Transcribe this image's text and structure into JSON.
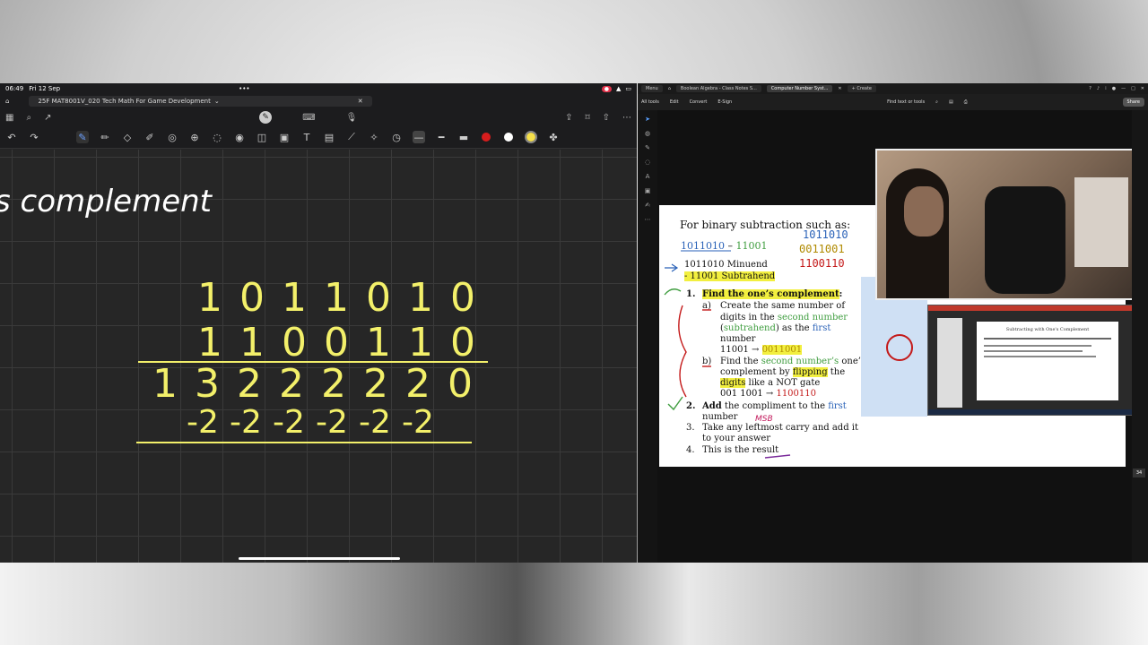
{
  "ipad": {
    "time": "06:49",
    "date": "Fri 12 Sep",
    "notebook_title": "25F MAT8001V_020 Tech Math For Game Development",
    "handwritten": {
      "heading": "s complement",
      "row1": [
        "1",
        "0",
        "1",
        "1",
        "0",
        "1",
        "0"
      ],
      "row2": [
        "1",
        "1",
        "0",
        "0",
        "1",
        "1",
        "0"
      ],
      "row3": [
        "1",
        "3",
        "2",
        "2",
        "2",
        "2",
        "2",
        "0"
      ],
      "row4": [
        "-2",
        "-2",
        "-2",
        "-2",
        "-2",
        "-2"
      ]
    },
    "colors": {
      "ink_white": "#ffffff",
      "ink_yellow": "#f3f06a",
      "swatch_red": "#d61d1d",
      "swatch_white": "#ffffff",
      "swatch_yellow": "#f6e04a"
    }
  },
  "pc": {
    "tabs": [
      {
        "label": "Menu"
      },
      {
        "label": "Boolean Algebra - Class Notes S..."
      },
      {
        "label": "Computer Number Syst..."
      },
      {
        "label": "+ Create"
      }
    ],
    "menu": [
      "All tools",
      "Edit",
      "Convert",
      "E-Sign"
    ],
    "find_label": "Find text or tools",
    "share_label": "Share",
    "page_number": "34",
    "doc": {
      "heading": "For binary subtraction such as:",
      "expr_a": "1011010",
      "expr_sep": " – ",
      "expr_b": "11001",
      "minuend": "1011010 Minuend",
      "subtrahend": "-  11001 Subtrahend",
      "step1": "1.",
      "step1_title": "Find the one’s complement",
      "step1_colon": ":",
      "a_label": "a)",
      "a_line1": "Create the same number of",
      "a_line2a": "digits in the ",
      "a_line2b": "second number",
      "a_line3a": "(",
      "a_line3b": "subtrahend",
      "a_line3c": ") as the ",
      "a_line3d": "first",
      "a_line4": "number",
      "a_line5a": "11001 → ",
      "a_line5b": "0011001",
      "b_label": "b)",
      "b_line1a": "Find the ",
      "b_line1b": "second number’s",
      "b_line1c": " one’s",
      "b_line2a": "complement by ",
      "b_line2b": "flipping",
      "b_line2c": " the",
      "b_line3a": "digits",
      "b_line3b": " like a NOT gate",
      "b_line4a": "001 1001 → ",
      "b_line4b": "1100110",
      "step2": "2.",
      "step2_a": "Add",
      "step2_b": " the compliment to the ",
      "step2_c": "first",
      "step2_d": "number",
      "msb": "MSB",
      "step3": "3.",
      "step3_a": "Take any leftmost carry and add it",
      "step3_b": "to your answer",
      "step4": "4.",
      "step4_a": "This is the result",
      "ink_rows": [
        "1011010",
        "0011001",
        "1100110"
      ]
    },
    "slide_title": "Subtracting with One's Complement"
  }
}
